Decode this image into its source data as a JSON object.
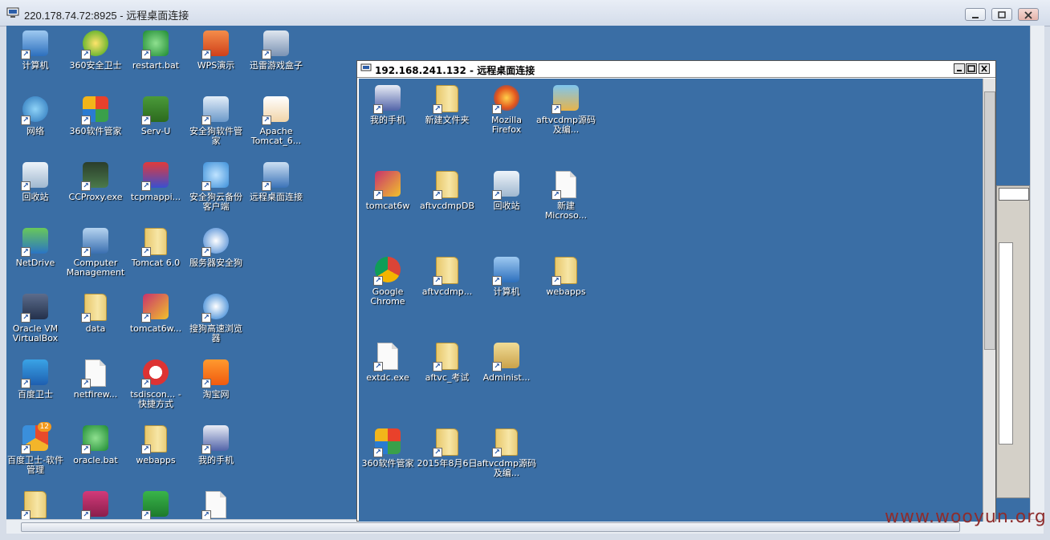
{
  "window": {
    "title": "220.178.74.72:8925 - 远程桌面连接"
  },
  "desktop_icons": [
    {
      "label": "计算机",
      "icon": "computer-icon",
      "col": 0,
      "row": 0
    },
    {
      "label": "360安全卫士",
      "icon": "360-safe-icon",
      "col": 1,
      "row": 0
    },
    {
      "label": "restart.bat",
      "icon": "bat-file-icon",
      "col": 2,
      "row": 0
    },
    {
      "label": "WPS演示",
      "icon": "wps-presentation-icon",
      "col": 3,
      "row": 0
    },
    {
      "label": "迅雷游戏盒子",
      "icon": "game-box-icon",
      "col": 4,
      "row": 0
    },
    {
      "label": "网络",
      "icon": "network-icon",
      "col": 0,
      "row": 1
    },
    {
      "label": "360软件管家",
      "icon": "360-software-icon",
      "col": 1,
      "row": 1
    },
    {
      "label": "Serv-U",
      "icon": "servu-icon",
      "col": 2,
      "row": 1
    },
    {
      "label": "安全狗软件管家",
      "icon": "safedog-software-icon",
      "col": 3,
      "row": 1
    },
    {
      "label": "Apache Tomcat_6...",
      "icon": "tomcat-png-icon",
      "col": 4,
      "row": 1
    },
    {
      "label": "回收站",
      "icon": "recycle-bin-icon",
      "col": 0,
      "row": 2
    },
    {
      "label": "CCProxy.exe",
      "icon": "ccproxy-icon",
      "col": 1,
      "row": 2
    },
    {
      "label": "tcpmappi...",
      "icon": "tcp-mapping-icon",
      "col": 2,
      "row": 2
    },
    {
      "label": "安全狗云备份客户端",
      "icon": "cloud-backup-icon",
      "col": 3,
      "row": 2
    },
    {
      "label": "远程桌面连接",
      "icon": "remote-desktop-icon",
      "col": 4,
      "row": 2
    },
    {
      "label": "NetDrive",
      "icon": "netdrive-icon",
      "col": 0,
      "row": 3
    },
    {
      "label": "Computer Management",
      "icon": "computer-management-icon",
      "col": 1,
      "row": 3
    },
    {
      "label": "Tomcat 6.0",
      "icon": "folder-icon",
      "col": 2,
      "row": 3
    },
    {
      "label": "服务器安全狗",
      "icon": "server-safedog-icon",
      "col": 3,
      "row": 3
    },
    {
      "label": "Oracle VM VirtualBox",
      "icon": "virtualbox-icon",
      "col": 0,
      "row": 4
    },
    {
      "label": "data",
      "icon": "folder-icon",
      "col": 1,
      "row": 4
    },
    {
      "label": "tomcat6w...",
      "icon": "tomcat-feather-icon",
      "col": 2,
      "row": 4
    },
    {
      "label": "搜狗高速浏览器",
      "icon": "sogou-browser-icon",
      "col": 3,
      "row": 4
    },
    {
      "label": "百度卫士",
      "icon": "baidu-guard-icon",
      "col": 0,
      "row": 5
    },
    {
      "label": "netfirew...",
      "icon": "text-file-icon",
      "col": 1,
      "row": 5
    },
    {
      "label": "tsdiscon... - 快捷方式",
      "icon": "tsdiscon-icon",
      "col": 2,
      "row": 5
    },
    {
      "label": "淘宝网",
      "icon": "taobao-icon",
      "col": 3,
      "row": 5
    },
    {
      "label": "百度卫士-软件管理",
      "icon": "baidu-software-icon",
      "col": 0,
      "row": 6,
      "badge": "12"
    },
    {
      "label": "oracle.bat",
      "icon": "bat-file-icon",
      "col": 1,
      "row": 6
    },
    {
      "label": "webapps",
      "icon": "folder-icon",
      "col": 2,
      "row": 6
    },
    {
      "label": "我的手机",
      "icon": "phone-icon",
      "col": 3,
      "row": 6
    },
    {
      "label": "",
      "icon": "folder-icon",
      "col": 0,
      "row": 7
    },
    {
      "label": "",
      "icon": "database-icon",
      "col": 1,
      "row": 7
    },
    {
      "label": "",
      "icon": "green-app-icon",
      "col": 2,
      "row": 7
    },
    {
      "label": "",
      "icon": "text-file-icon",
      "col": 3,
      "row": 7
    }
  ],
  "inner_window": {
    "title": "192.168.241.132 - 远程桌面连接",
    "icons": [
      {
        "label": "我的手机",
        "icon": "phone-icon",
        "col": 0,
        "row": 0
      },
      {
        "label": "新建文件夹",
        "icon": "folder-icon",
        "col": 1,
        "row": 0
      },
      {
        "label": "Mozilla Firefox",
        "icon": "firefox-icon",
        "col": 2,
        "row": 0
      },
      {
        "label": "aftvcdmp源码及编...",
        "icon": "archive-icon",
        "col": 3,
        "row": 0
      },
      {
        "label": "tomcat6w",
        "icon": "tomcat-feather-icon",
        "col": 0,
        "row": 1
      },
      {
        "label": "aftvcdmpDB",
        "icon": "folder-icon",
        "col": 1,
        "row": 1
      },
      {
        "label": "回收站",
        "icon": "recycle-bin-icon",
        "col": 2,
        "row": 1
      },
      {
        "label": "新建 Microso...",
        "icon": "blank-doc-icon",
        "col": 3,
        "row": 1
      },
      {
        "label": "Google Chrome",
        "icon": "chrome-icon",
        "col": 0,
        "row": 2
      },
      {
        "label": "aftvcdmp...",
        "icon": "folder-icon",
        "col": 1,
        "row": 2
      },
      {
        "label": "计算机",
        "icon": "computer-icon",
        "col": 2,
        "row": 2
      },
      {
        "label": "webapps",
        "icon": "folder-icon",
        "col": 3,
        "row": 2
      },
      {
        "label": "extdc.exe",
        "icon": "text-file-icon",
        "col": 0,
        "row": 3
      },
      {
        "label": "aftvc_考试",
        "icon": "folder-icon",
        "col": 1,
        "row": 3
      },
      {
        "label": "Administ...",
        "icon": "user-folder-icon",
        "col": 2,
        "row": 3
      },
      {
        "label": "360软件管家",
        "icon": "360-software-icon",
        "col": 0,
        "row": 4
      },
      {
        "label": "2015年8月6日",
        "icon": "folder-icon",
        "col": 1,
        "row": 4
      },
      {
        "label": "aftvcdmp源码及编...",
        "icon": "folder-icon",
        "col": 2,
        "row": 4
      }
    ]
  },
  "watermark": "www.wooyun.org",
  "colors": {
    "desktop": "#3a6ea5",
    "title_bar": "#dfe6f1"
  }
}
